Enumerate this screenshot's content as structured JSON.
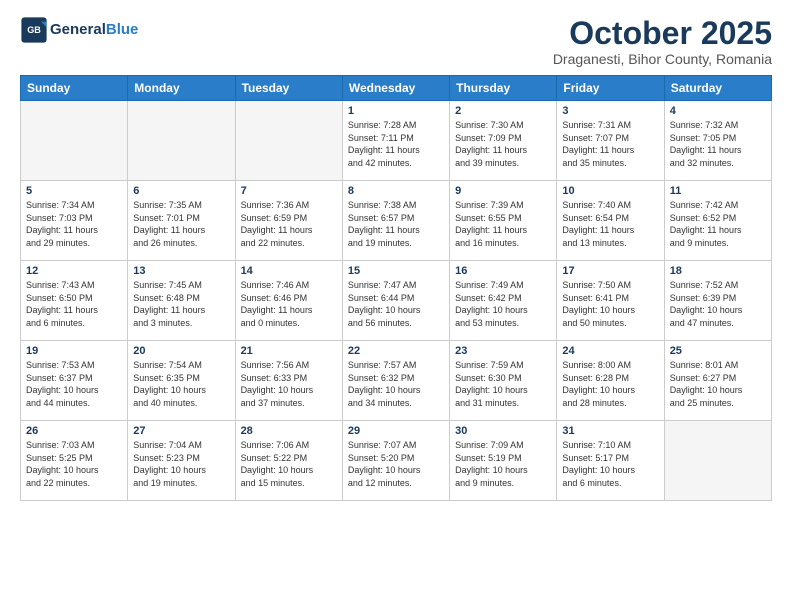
{
  "header": {
    "logo_line1": "General",
    "logo_line2": "Blue",
    "month_title": "October 2025",
    "subtitle": "Draganesti, Bihor County, Romania"
  },
  "weekdays": [
    "Sunday",
    "Monday",
    "Tuesday",
    "Wednesday",
    "Thursday",
    "Friday",
    "Saturday"
  ],
  "weeks": [
    [
      {
        "day": "",
        "info": "",
        "empty": true
      },
      {
        "day": "",
        "info": "",
        "empty": true
      },
      {
        "day": "",
        "info": "",
        "empty": true
      },
      {
        "day": "1",
        "info": "Sunrise: 7:28 AM\nSunset: 7:11 PM\nDaylight: 11 hours\nand 42 minutes.",
        "empty": false
      },
      {
        "day": "2",
        "info": "Sunrise: 7:30 AM\nSunset: 7:09 PM\nDaylight: 11 hours\nand 39 minutes.",
        "empty": false
      },
      {
        "day": "3",
        "info": "Sunrise: 7:31 AM\nSunset: 7:07 PM\nDaylight: 11 hours\nand 35 minutes.",
        "empty": false
      },
      {
        "day": "4",
        "info": "Sunrise: 7:32 AM\nSunset: 7:05 PM\nDaylight: 11 hours\nand 32 minutes.",
        "empty": false
      }
    ],
    [
      {
        "day": "5",
        "info": "Sunrise: 7:34 AM\nSunset: 7:03 PM\nDaylight: 11 hours\nand 29 minutes.",
        "empty": false
      },
      {
        "day": "6",
        "info": "Sunrise: 7:35 AM\nSunset: 7:01 PM\nDaylight: 11 hours\nand 26 minutes.",
        "empty": false
      },
      {
        "day": "7",
        "info": "Sunrise: 7:36 AM\nSunset: 6:59 PM\nDaylight: 11 hours\nand 22 minutes.",
        "empty": false
      },
      {
        "day": "8",
        "info": "Sunrise: 7:38 AM\nSunset: 6:57 PM\nDaylight: 11 hours\nand 19 minutes.",
        "empty": false
      },
      {
        "day": "9",
        "info": "Sunrise: 7:39 AM\nSunset: 6:55 PM\nDaylight: 11 hours\nand 16 minutes.",
        "empty": false
      },
      {
        "day": "10",
        "info": "Sunrise: 7:40 AM\nSunset: 6:54 PM\nDaylight: 11 hours\nand 13 minutes.",
        "empty": false
      },
      {
        "day": "11",
        "info": "Sunrise: 7:42 AM\nSunset: 6:52 PM\nDaylight: 11 hours\nand 9 minutes.",
        "empty": false
      }
    ],
    [
      {
        "day": "12",
        "info": "Sunrise: 7:43 AM\nSunset: 6:50 PM\nDaylight: 11 hours\nand 6 minutes.",
        "empty": false
      },
      {
        "day": "13",
        "info": "Sunrise: 7:45 AM\nSunset: 6:48 PM\nDaylight: 11 hours\nand 3 minutes.",
        "empty": false
      },
      {
        "day": "14",
        "info": "Sunrise: 7:46 AM\nSunset: 6:46 PM\nDaylight: 11 hours\nand 0 minutes.",
        "empty": false
      },
      {
        "day": "15",
        "info": "Sunrise: 7:47 AM\nSunset: 6:44 PM\nDaylight: 10 hours\nand 56 minutes.",
        "empty": false
      },
      {
        "day": "16",
        "info": "Sunrise: 7:49 AM\nSunset: 6:42 PM\nDaylight: 10 hours\nand 53 minutes.",
        "empty": false
      },
      {
        "day": "17",
        "info": "Sunrise: 7:50 AM\nSunset: 6:41 PM\nDaylight: 10 hours\nand 50 minutes.",
        "empty": false
      },
      {
        "day": "18",
        "info": "Sunrise: 7:52 AM\nSunset: 6:39 PM\nDaylight: 10 hours\nand 47 minutes.",
        "empty": false
      }
    ],
    [
      {
        "day": "19",
        "info": "Sunrise: 7:53 AM\nSunset: 6:37 PM\nDaylight: 10 hours\nand 44 minutes.",
        "empty": false
      },
      {
        "day": "20",
        "info": "Sunrise: 7:54 AM\nSunset: 6:35 PM\nDaylight: 10 hours\nand 40 minutes.",
        "empty": false
      },
      {
        "day": "21",
        "info": "Sunrise: 7:56 AM\nSunset: 6:33 PM\nDaylight: 10 hours\nand 37 minutes.",
        "empty": false
      },
      {
        "day": "22",
        "info": "Sunrise: 7:57 AM\nSunset: 6:32 PM\nDaylight: 10 hours\nand 34 minutes.",
        "empty": false
      },
      {
        "day": "23",
        "info": "Sunrise: 7:59 AM\nSunset: 6:30 PM\nDaylight: 10 hours\nand 31 minutes.",
        "empty": false
      },
      {
        "day": "24",
        "info": "Sunrise: 8:00 AM\nSunset: 6:28 PM\nDaylight: 10 hours\nand 28 minutes.",
        "empty": false
      },
      {
        "day": "25",
        "info": "Sunrise: 8:01 AM\nSunset: 6:27 PM\nDaylight: 10 hours\nand 25 minutes.",
        "empty": false
      }
    ],
    [
      {
        "day": "26",
        "info": "Sunrise: 7:03 AM\nSunset: 5:25 PM\nDaylight: 10 hours\nand 22 minutes.",
        "empty": false
      },
      {
        "day": "27",
        "info": "Sunrise: 7:04 AM\nSunset: 5:23 PM\nDaylight: 10 hours\nand 19 minutes.",
        "empty": false
      },
      {
        "day": "28",
        "info": "Sunrise: 7:06 AM\nSunset: 5:22 PM\nDaylight: 10 hours\nand 15 minutes.",
        "empty": false
      },
      {
        "day": "29",
        "info": "Sunrise: 7:07 AM\nSunset: 5:20 PM\nDaylight: 10 hours\nand 12 minutes.",
        "empty": false
      },
      {
        "day": "30",
        "info": "Sunrise: 7:09 AM\nSunset: 5:19 PM\nDaylight: 10 hours\nand 9 minutes.",
        "empty": false
      },
      {
        "day": "31",
        "info": "Sunrise: 7:10 AM\nSunset: 5:17 PM\nDaylight: 10 hours\nand 6 minutes.",
        "empty": false
      },
      {
        "day": "",
        "info": "",
        "empty": true
      }
    ]
  ]
}
